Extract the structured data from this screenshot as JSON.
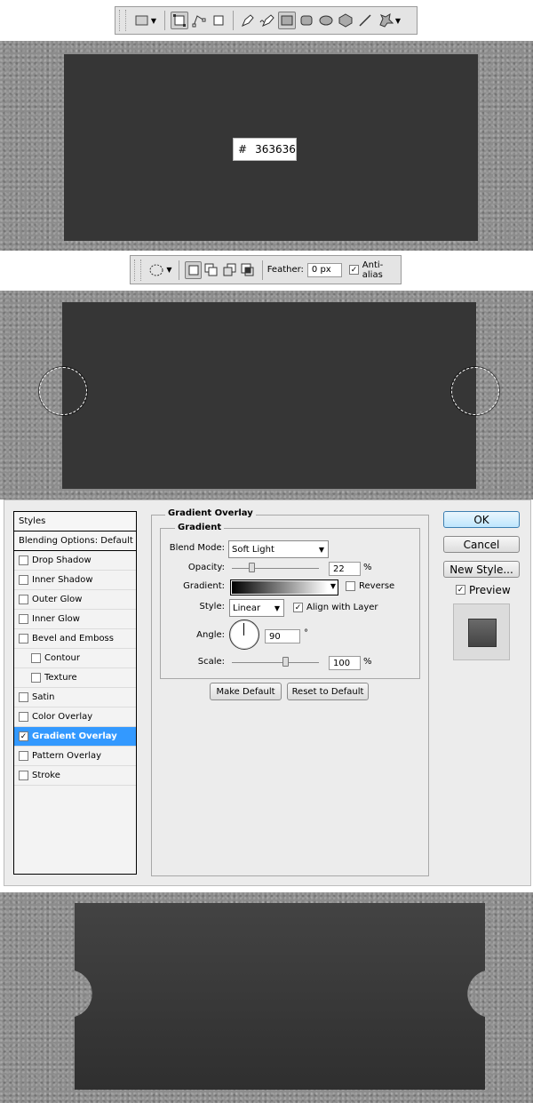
{
  "shape_toolbar": {
    "tools": [
      "rectangle-shape-icon",
      "shape-layers-icon",
      "paths-icon",
      "fill-pixels-icon",
      "pen-icon",
      "freeform-pen-icon",
      "rectangle-icon",
      "rounded-rectangle-icon",
      "ellipse-icon",
      "polygon-icon",
      "line-icon",
      "custom-shape-icon"
    ]
  },
  "color_popup": {
    "hash": "#",
    "value": "363636"
  },
  "marquee_toolbar": {
    "feather_label": "Feather:",
    "feather_value": "0 px",
    "antialias_label": "Anti-alias",
    "antialias_checked": true
  },
  "layer_style": {
    "styles_list": {
      "header": "Styles",
      "blending": "Blending Options: Default",
      "items": [
        {
          "label": "Drop Shadow",
          "checked": false,
          "sub": false
        },
        {
          "label": "Inner Shadow",
          "checked": false,
          "sub": false
        },
        {
          "label": "Outer Glow",
          "checked": false,
          "sub": false
        },
        {
          "label": "Inner Glow",
          "checked": false,
          "sub": false
        },
        {
          "label": "Bevel and Emboss",
          "checked": false,
          "sub": false
        },
        {
          "label": "Contour",
          "checked": false,
          "sub": true
        },
        {
          "label": "Texture",
          "checked": false,
          "sub": true
        },
        {
          "label": "Satin",
          "checked": false,
          "sub": false
        },
        {
          "label": "Color Overlay",
          "checked": false,
          "sub": false
        },
        {
          "label": "Gradient Overlay",
          "checked": true,
          "sub": false,
          "selected": true
        },
        {
          "label": "Pattern Overlay",
          "checked": false,
          "sub": false
        },
        {
          "label": "Stroke",
          "checked": false,
          "sub": false
        }
      ]
    },
    "panel_title": "Gradient Overlay",
    "group_title": "Gradient",
    "blend_mode_label": "Blend Mode:",
    "blend_mode_value": "Soft Light",
    "opacity_label": "Opacity:",
    "opacity_value": "22",
    "opacity_fraction": 0.22,
    "percent": "%",
    "gradient_label": "Gradient:",
    "reverse_label": "Reverse",
    "style_label": "Style:",
    "style_value": "Linear",
    "align_label": "Align with Layer",
    "angle_label": "Angle:",
    "angle_value": "90",
    "degree": "°",
    "scale_label": "Scale:",
    "scale_value": "100",
    "make_default": "Make Default",
    "reset_default": "Reset to Default",
    "ok": "OK",
    "cancel": "Cancel",
    "new_style": "New Style...",
    "preview_label": "Preview"
  },
  "colors": {
    "card": "#363636",
    "texture": "#8c8c8c",
    "highlight": "#3399ff"
  }
}
